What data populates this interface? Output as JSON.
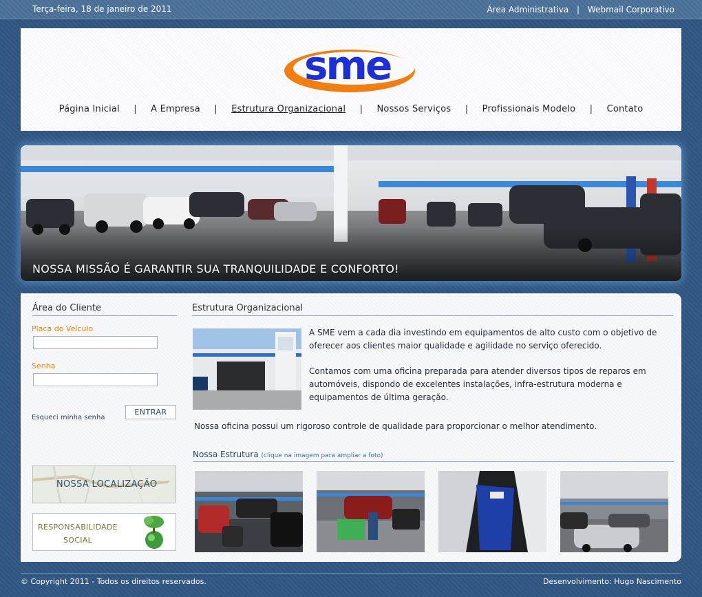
{
  "topbar": {
    "date": "Terça-feira, 18 de janeiro de 2011",
    "links": [
      "Área Administrativa",
      "Webmail Corporativo"
    ],
    "separator": "|"
  },
  "logo": {
    "text": "sme",
    "colors": {
      "swoosh": "#f07e10",
      "letters": "#1e2fd6"
    }
  },
  "nav": {
    "items": [
      "Página Inicial",
      "A Empresa",
      "Estrutura Organizacional",
      "Nossos Serviços",
      "Profissionais Modelo",
      "Contato"
    ],
    "active": "Estrutura Organizacional",
    "separator": "|"
  },
  "banner": {
    "caption": "NOSSA MISSÃO É GARANTIR SUA TRANQUILIDADE E CONFORTO!"
  },
  "sidebar": {
    "title": "Área do Cliente",
    "plate_label": "Placa do Veículo",
    "plate_value": "",
    "password_label": "Senha",
    "password_value": "",
    "forgot": "Esqueci minha senha",
    "submit": "ENTRAR",
    "promo_location": "NOSSA LOCALIZAÇÃO",
    "promo_social_line1": "RESPONSABILIDADE",
    "promo_social_line2": "SOCIAL"
  },
  "main": {
    "title": "Estrutura Organizacional",
    "paragraph1": "A SME vem a cada dia investindo em equipamentos de alto custo com o objetivo de oferecer aos clientes maior qualidade e agilidade no serviço oferecido.",
    "paragraph2": "Contamos com uma oficina preparada para atender diversos tipos de reparos em automóveis, dispondo de excelentes instalações, infra-estrutura moderna e equipamentos de última geração.",
    "paragraph3": "Nossa oficina possui um rigoroso controle de qualidade para proporcionar o melhor atendimento.",
    "gallery_title": "Nossa Estrutura",
    "gallery_hint": "(clique na imagem para ampliar a foto)"
  },
  "footer": {
    "copyright": "© Copyright 2011 - Todos os direitos reservados.",
    "developer": "Desenvolvimento: Hugo Nascimento"
  },
  "colors": {
    "accent_orange": "#e8870a",
    "page_blue": "#2f5580",
    "link_blue": "#2c4563"
  }
}
